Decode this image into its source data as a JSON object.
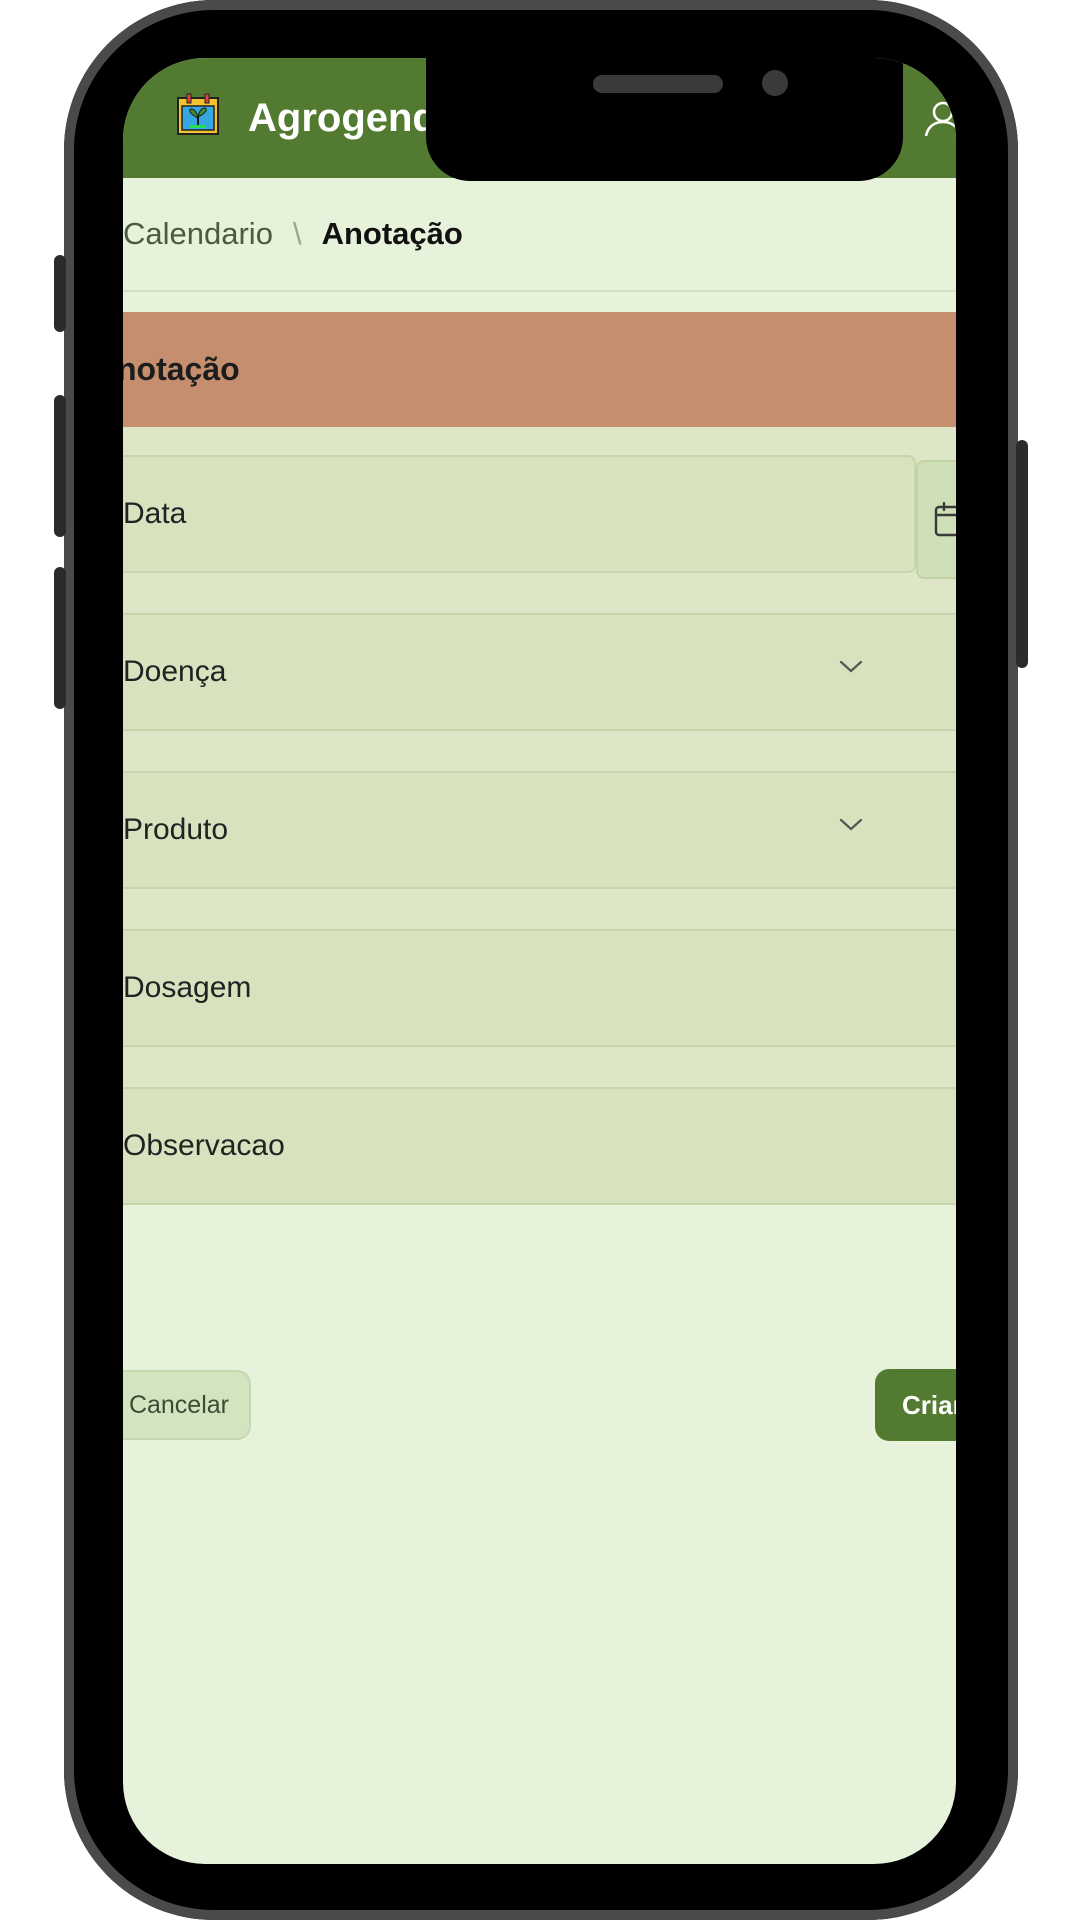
{
  "app": {
    "title": "Agrogenda"
  },
  "breadcrumb": {
    "parent": "Calendario",
    "separator": "\\",
    "current": "Anotação"
  },
  "form": {
    "title": "notação",
    "fields": {
      "data": "Data",
      "doenca": "Doença",
      "produto": "Produto",
      "dosagem": "Dosagem",
      "observacao": "Observacao"
    },
    "cancel_label": "Cancelar",
    "create_label": "Criar"
  },
  "colors": {
    "appbar": "#527a30",
    "background": "#e6f2d9",
    "card_header": "#c48e6f",
    "card_body": "#dde7c7"
  }
}
